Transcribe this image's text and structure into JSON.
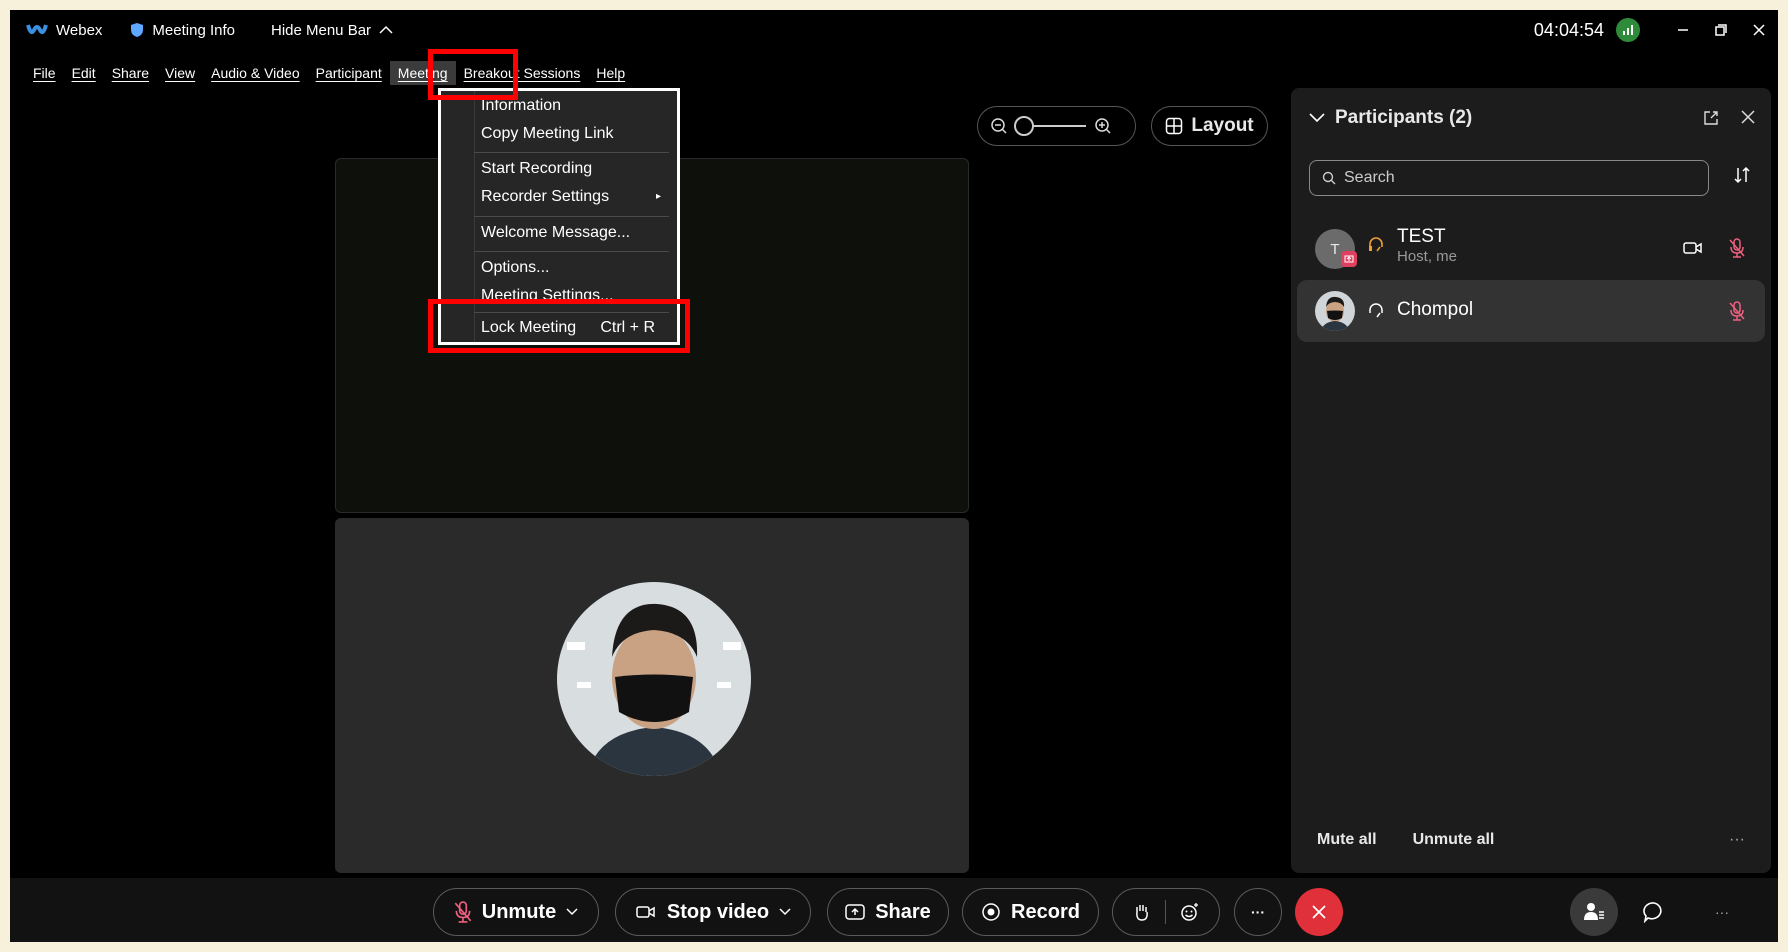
{
  "titlebar": {
    "app_name": "Webex",
    "meeting_info": "Meeting Info",
    "hide_menu": "Hide Menu Bar",
    "clock": "04:04:54"
  },
  "menubar": {
    "items": [
      "File",
      "Edit",
      "Share",
      "View",
      "Audio & Video",
      "Participant",
      "Meeting",
      "Breakout Sessions",
      "Help"
    ],
    "active": "Meeting"
  },
  "meeting_menu": {
    "information": "Information",
    "copy_link": "Copy Meeting Link",
    "start_recording": "Start Recording",
    "recorder_settings": "Recorder Settings",
    "welcome_message": "Welcome Message...",
    "options": "Options...",
    "meeting_settings": "Meeting Settings...",
    "lock_meeting": "Lock Meeting",
    "lock_shortcut": "Ctrl + R"
  },
  "view": {
    "layout_label": "Layout"
  },
  "participants": {
    "title": "Participants (2)",
    "search_placeholder": "Search",
    "list": [
      {
        "name": "TEST",
        "role": "Host, me",
        "initial": "T"
      },
      {
        "name": "Chompol",
        "role": ""
      }
    ],
    "mute_all": "Mute all",
    "unmute_all": "Unmute all"
  },
  "toolbar": {
    "unmute": "Unmute",
    "stop_video": "Stop video",
    "share": "Share",
    "record": "Record"
  },
  "colors": {
    "highlight": "#ff0000",
    "end_call": "#e0303a",
    "mic_muted": "#f06080",
    "host_badge": "#f0a030"
  }
}
